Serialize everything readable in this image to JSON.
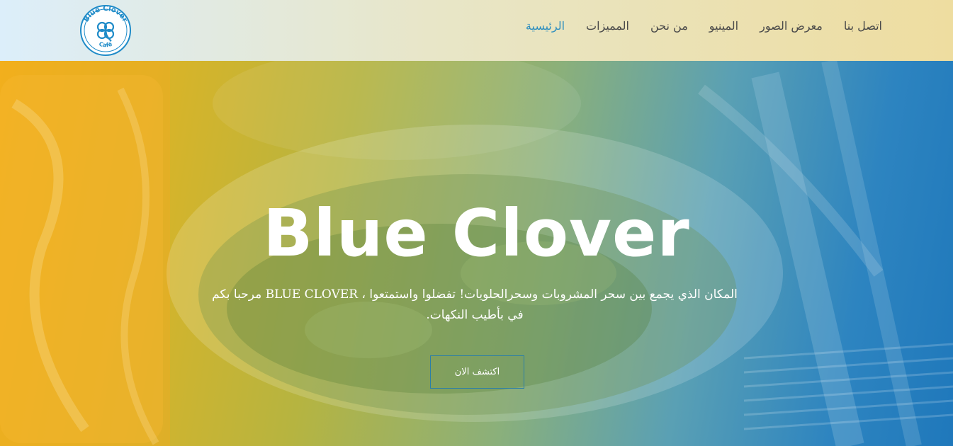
{
  "header": {
    "logo": {
      "text_top": "Blue Clover",
      "text_bottom": "Café",
      "icon": "clover-icon",
      "color": "#1f8bc8"
    },
    "nav": [
      {
        "label": "الرئيسية",
        "active": true
      },
      {
        "label": "المميزات",
        "active": false
      },
      {
        "label": "من نحن",
        "active": false
      },
      {
        "label": "المينيو",
        "active": false
      },
      {
        "label": "معرض الصور",
        "active": false
      },
      {
        "label": "اتصل بنا",
        "active": false
      }
    ]
  },
  "hero": {
    "title": "Blue Clover",
    "text": "المكان الذي يجمع بين سحر المشروبات وسحرالحلويات! تفضلوا واستمتعوا ، BLUE CLOVER مرحبا بكم في بأطيب النكهات.",
    "cta_label": "اكتشف الان"
  },
  "colors": {
    "accent": "#2f8fbf",
    "gradient_left": "#f0b41c",
    "gradient_right": "#1f78bb"
  }
}
